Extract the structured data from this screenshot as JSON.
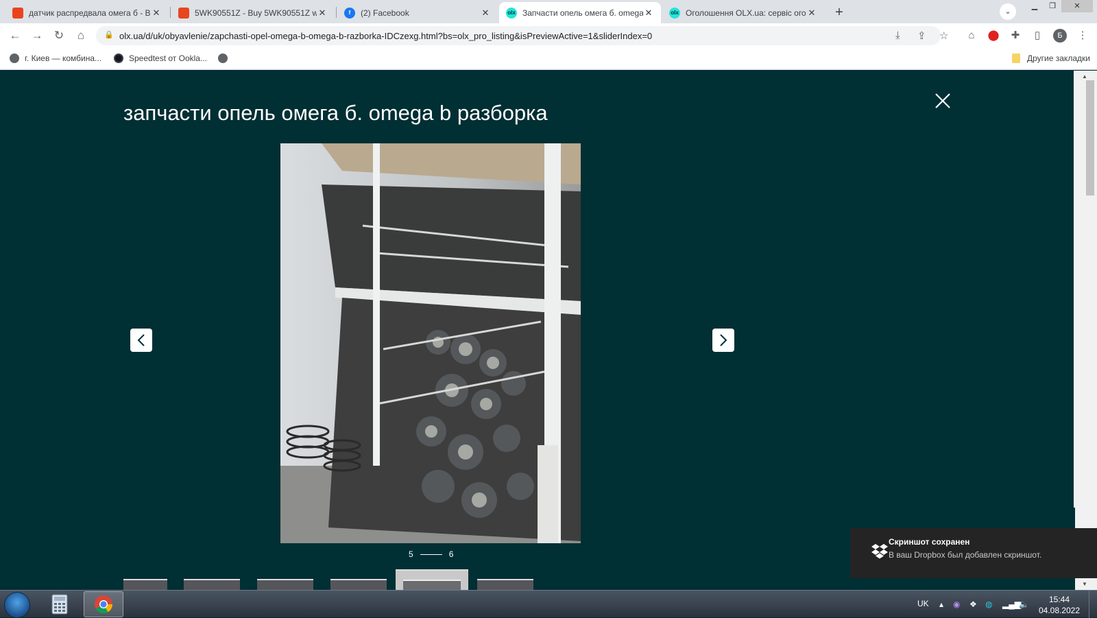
{
  "browser": {
    "tabs": [
      {
        "title": "датчик распредвала омега б - В",
        "favicon_color": "#e8451f",
        "active": false
      },
      {
        "title": "5WK90551Z - Buy 5WK90551Z w",
        "favicon_color": "#e8451f",
        "active": false
      },
      {
        "title": "(2) Facebook",
        "favicon_color": "#1877f2",
        "active": false
      },
      {
        "title": "Запчасти опель омега б. omega",
        "favicon_color": "#23e5db",
        "active": true
      },
      {
        "title": "Оголошення OLX.ua: сервіс ого",
        "favicon_color": "#23e5db",
        "active": false
      }
    ],
    "olx_favicon_text": "olx",
    "url": "olx.ua/d/uk/obyavlenie/zapchasti-opel-omega-b-omega-b-razborka-IDCzexg.html?bs=olx_pro_listing&isPreviewActive=1&sliderIndex=0",
    "profile_initial": "Б",
    "bookmarks": [
      {
        "label": "г. Киев — комбина..."
      },
      {
        "label": "Speedtest от Ookla..."
      },
      {
        "label": ""
      }
    ],
    "other_bookmarks": "Другие закладки"
  },
  "viewer": {
    "title": "запчасти опель омега б. omega b разборка",
    "counter_current": "5",
    "counter_total": "6",
    "thumbnail_count": 6,
    "active_thumbnail": 5
  },
  "toast": {
    "title": "Скриншот сохранен",
    "message": "В ваш Dropbox был добавлен скриншот."
  },
  "taskbar": {
    "language": "UK",
    "time": "15:44",
    "date": "04.08.2022"
  },
  "colors": {
    "olx_dark": "#002f34",
    "toast_bg": "#242424"
  }
}
